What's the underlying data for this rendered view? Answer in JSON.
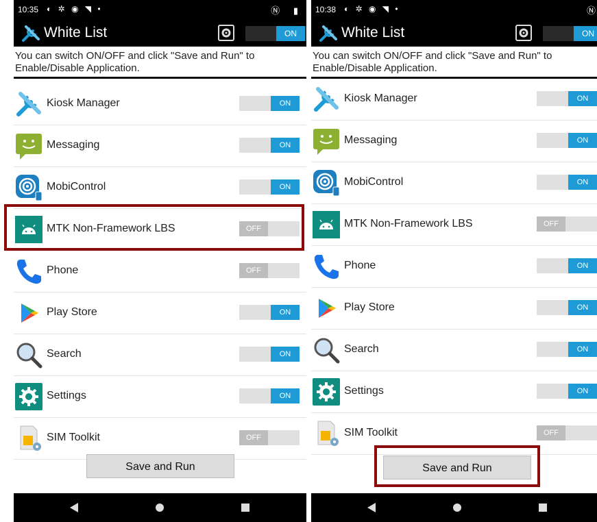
{
  "screens": [
    {
      "status_time": "10:35",
      "title": "White List",
      "master_toggle": "ON",
      "description": "You can switch ON/OFF and click \"Save and Run\" to Enable/Disable Application.",
      "apps": [
        {
          "name": "Kiosk Manager",
          "state": "ON",
          "icon": "kiosk-manager-icon"
        },
        {
          "name": "Messaging",
          "state": "ON",
          "icon": "messaging-icon"
        },
        {
          "name": "MobiControl",
          "state": "ON",
          "icon": "mobicontrol-icon"
        },
        {
          "name": "MTK Non-Framework LBS",
          "state": "OFF",
          "icon": "android-icon"
        },
        {
          "name": "Phone",
          "state": "OFF",
          "icon": "phone-icon"
        },
        {
          "name": "Play Store",
          "state": "ON",
          "icon": "play-store-icon"
        },
        {
          "name": "Search",
          "state": "ON",
          "icon": "search-icon"
        },
        {
          "name": "Settings",
          "state": "ON",
          "icon": "settings-icon"
        },
        {
          "name": "SIM Toolkit",
          "state": "OFF",
          "icon": "sim-toolkit-icon"
        }
      ],
      "save_label": "Save and Run"
    },
    {
      "status_time": "10:38",
      "title": "White List",
      "master_toggle": "ON",
      "description": "You can switch ON/OFF and click \"Save and Run\" to Enable/Disable Application.",
      "apps": [
        {
          "name": "Kiosk Manager",
          "state": "ON",
          "icon": "kiosk-manager-icon"
        },
        {
          "name": "Messaging",
          "state": "ON",
          "icon": "messaging-icon"
        },
        {
          "name": "MobiControl",
          "state": "ON",
          "icon": "mobicontrol-icon"
        },
        {
          "name": "MTK Non-Framework LBS",
          "state": "OFF",
          "icon": "android-icon"
        },
        {
          "name": "Phone",
          "state": "ON",
          "icon": "phone-icon"
        },
        {
          "name": "Play Store",
          "state": "ON",
          "icon": "play-store-icon"
        },
        {
          "name": "Search",
          "state": "ON",
          "icon": "search-icon"
        },
        {
          "name": "Settings",
          "state": "ON",
          "icon": "settings-icon"
        },
        {
          "name": "SIM Toolkit",
          "state": "OFF",
          "icon": "sim-toolkit-icon"
        }
      ],
      "save_label": "Save and Run"
    }
  ],
  "colors": {
    "toggle_on": "#1e9ad6",
    "toggle_off": "#bdbdbd",
    "highlight": "#8b0b0b",
    "settings_teal": "#0f8e7f",
    "messaging_green": "#8db032"
  }
}
